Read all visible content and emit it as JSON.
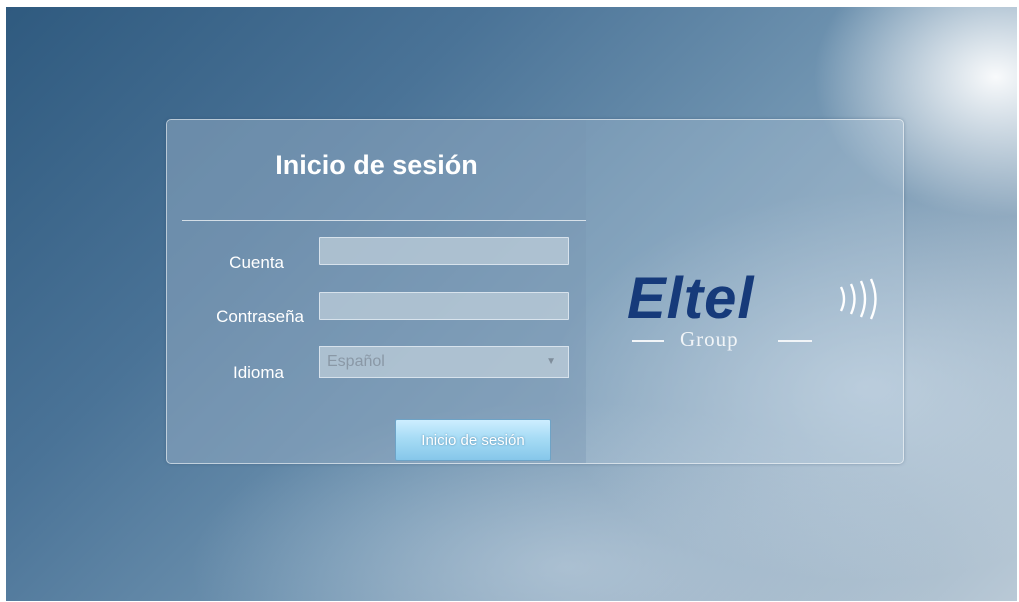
{
  "login": {
    "title": "Inicio de sesión",
    "account_label": "Cuenta",
    "account_value": "",
    "password_label": "Contraseña",
    "password_value": "",
    "language_label": "Idioma",
    "language_selected": "Español",
    "submit_label": "Inicio de sesión"
  },
  "brand": {
    "name": "Eltel",
    "subtitle": "Group",
    "color": "#163a7a"
  },
  "icons": {
    "dropdown": "chevron-down-icon",
    "signal": "signal-waves-icon"
  }
}
